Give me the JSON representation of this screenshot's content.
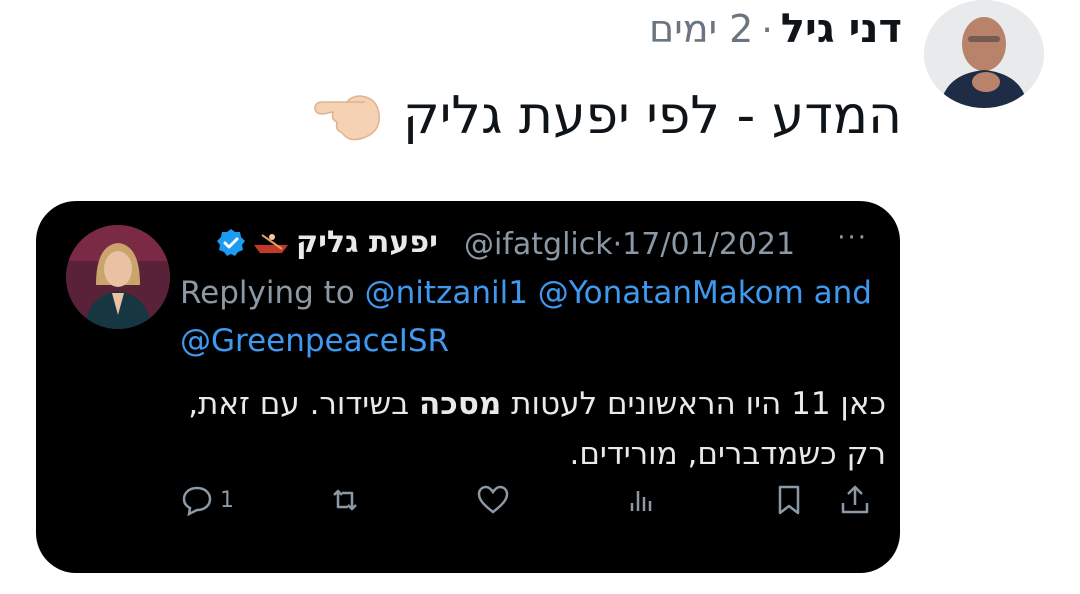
{
  "post": {
    "author": "דני גיל",
    "separator": "·",
    "time": "2 ימים",
    "text": "המדע - לפי יפעת גליק",
    "avatar_icon": "user-photo",
    "emoji_icon": "backhand-index-pointing-left"
  },
  "quoted_tweet": {
    "name": "יפעת גליק",
    "handle": "@ifatglick",
    "date_separator": "·",
    "date": "17/01/2021",
    "more": "···",
    "replying_prefix": "Replying to",
    "mention1": "@nitzanil1",
    "mention2": "@YonatanMakom",
    "and_word": "and",
    "mention3": "@GreenpeaceISR",
    "body_part1": "כאן 11 היו הראשונים לעטות ",
    "body_bold": "מסכה",
    "body_part2": " בשידור. עם זאת, רק כשמדברים, מורידים.",
    "reply_count": "1",
    "colors": {
      "background": "#000000",
      "text": "#e7e9ea",
      "muted": "#8b98a5",
      "link": "#3f99f0",
      "verified": "#1d9bf0"
    }
  }
}
